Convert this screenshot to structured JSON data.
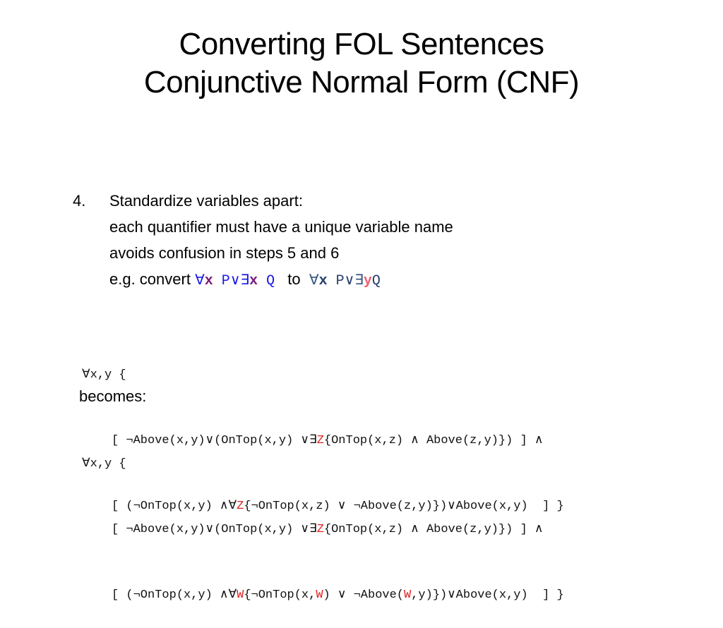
{
  "slide": {
    "title_lines": [
      "Converting FOL Sentences",
      "Conjunctive Normal Form (CNF)"
    ],
    "step": {
      "number": "4.",
      "heading": "Standardize variables apart:",
      "lines": [
        "each quantifier must have a unique variable name",
        "avoids confusion in steps 5 and 6"
      ],
      "example_prefix": "e.g. convert",
      "example_mid": "to",
      "example_before": {
        "forall": "∀",
        "var1": "x",
        "p": "P",
        "or": "∨",
        "exists": "∃",
        "var2": "x",
        "q": "Q"
      },
      "example_after": {
        "forall": "∀",
        "var1": "x",
        "p": "P",
        "or": "∨",
        "exists": "∃",
        "var2": "y",
        "q": "Q"
      }
    },
    "original": {
      "header": "∀x,y {",
      "line1": {
        "a": "[ ¬Above(x,y)∨(OnTop(x,y) ∨",
        "q": "∃",
        "var": "Z",
        "b": "{OnTop(x,z) ∧ Above(z,y)}) ] ∧"
      },
      "line2": {
        "a": "[ (¬OnTop(x,y) ∧",
        "q": "∀",
        "var": "Z",
        "b": "{¬OnTop(x,z) ∨ ¬Above(z,y)})∨Above(x,y)  ] }"
      }
    },
    "becomes_label": "becomes:",
    "converted": {
      "header": "∀x,y {",
      "line1": {
        "a": "[ ¬Above(x,y)∨(OnTop(x,y) ∨",
        "q": "∃",
        "var": "Z",
        "b": "{OnTop(x,z) ∧ Above(z,y)}) ] ∧"
      },
      "line2": {
        "a": "[ (¬OnTop(x,y) ∧",
        "q": "∀",
        "var": "W",
        "b": "{¬OnTop(x,",
        "var2": "W",
        "c": ") ∨ ¬Above(",
        "var3": "W",
        "d": ",y)})∨Above(x,y)  ] }"
      }
    },
    "colors": {
      "quantifier_blue": "#1a1ae6",
      "variable_purple": "#7a1a7a",
      "renamed_pink": "#f06070",
      "highlight_red": "#e02020"
    }
  }
}
